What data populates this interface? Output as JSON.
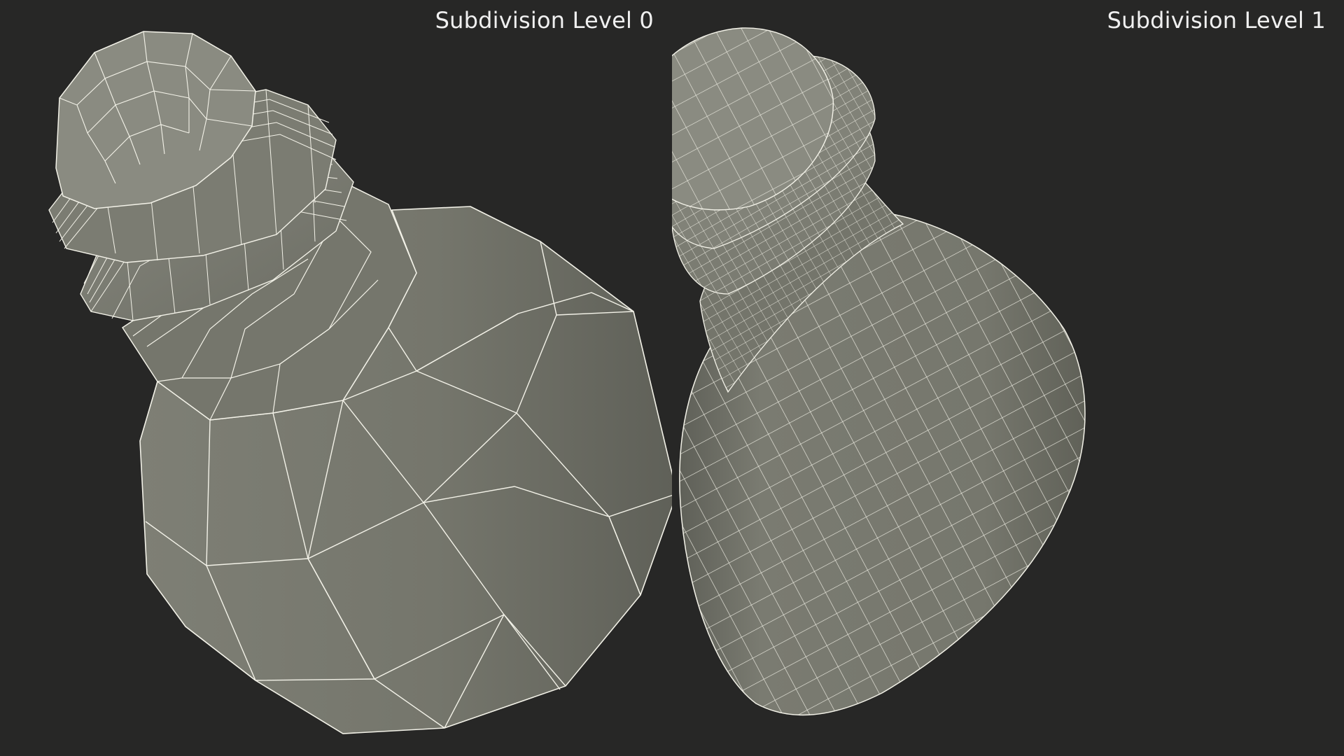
{
  "panels": [
    {
      "label": "Subdivision Level 0"
    },
    {
      "label": "Subdivision Level 1"
    }
  ],
  "colors": {
    "background": "#272726",
    "mesh_fill": "#7a7b70",
    "mesh_shadow": "#5f6057",
    "wireframe": "#f4f3ea"
  }
}
